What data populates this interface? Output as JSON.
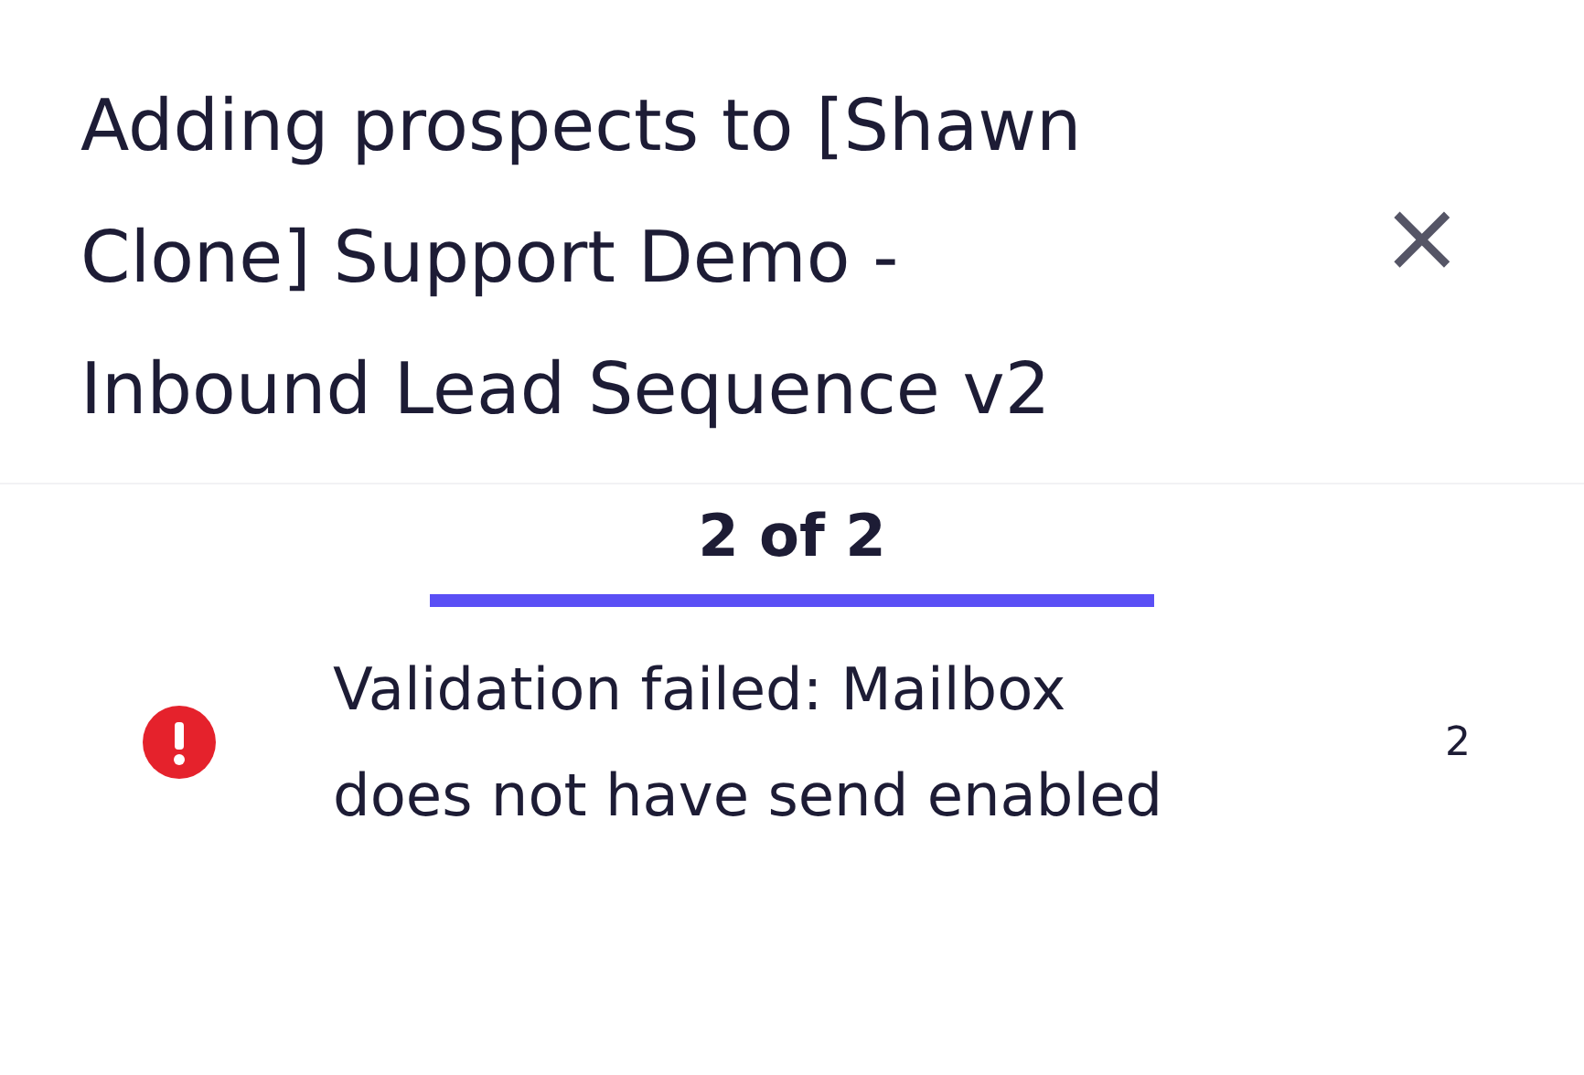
{
  "dialog": {
    "title_lines": [
      "Adding prospects to [Shawn",
      "Clone] Support Demo -",
      "Inbound Lead Sequence v2"
    ],
    "close": "×"
  },
  "progress": {
    "label": "2 of 2"
  },
  "errors": [
    {
      "kind": "error",
      "message_lines": [
        "Validation failed: Mailbox",
        "does not have send enabled"
      ],
      "count": "2"
    }
  ]
}
